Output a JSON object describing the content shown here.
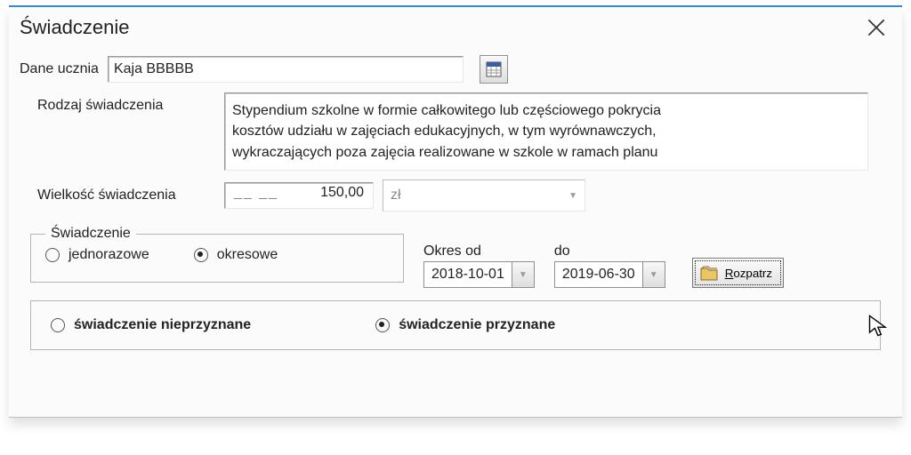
{
  "window": {
    "title": "Świadczenie"
  },
  "student": {
    "label": "Dane ucznia",
    "name": "Kaja BBBBB"
  },
  "type": {
    "label": "Rodzaj świadczenia",
    "line1": "Stypendium szkolne w formie całkowitego lub częściowego pokrycia",
    "line2": "kosztów udziału w zajęciach edukacyjnych, w tym wyrównawczych,",
    "line3": "wykraczających poza zajęcia realizowane w szkole w ramach planu"
  },
  "amount": {
    "label": "Wielkość świadczenia",
    "value": "150,00",
    "unit": "zł"
  },
  "benefit_mode": {
    "legend": "Świadczenie",
    "one_time": "jednorazowe",
    "periodic": "okresowe",
    "selected": "periodic"
  },
  "period": {
    "from_label": "Okres od",
    "to_label": "do",
    "from": "2018-10-01",
    "to": "2019-06-30"
  },
  "actions": {
    "process": "Rozpatrz"
  },
  "decision": {
    "denied": "świadczenie nieprzyznane",
    "granted": "świadczenie przyznane",
    "selected": "granted"
  }
}
